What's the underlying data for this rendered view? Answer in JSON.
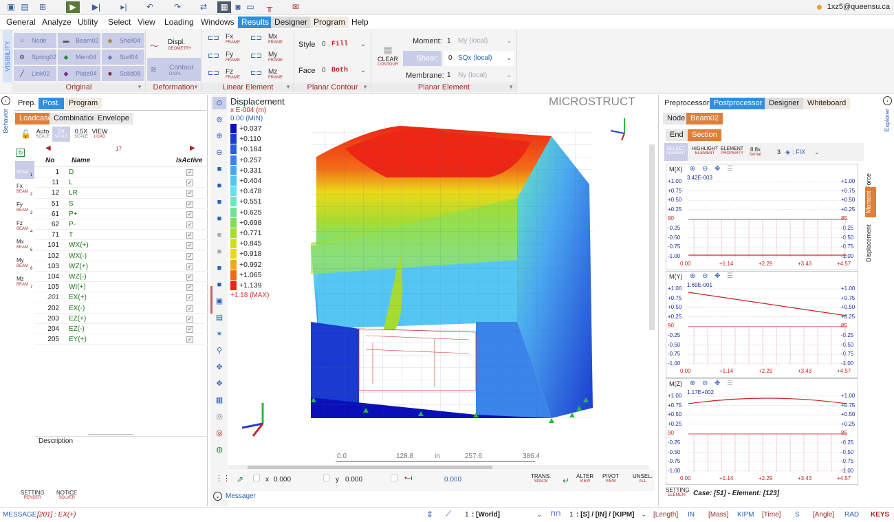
{
  "user": {
    "email": "1xz5@queensu.ca"
  },
  "menu": [
    "General",
    "Analyze",
    "Utility",
    "Select",
    "View",
    "Loading",
    "Windows",
    "Results",
    "Designer",
    "Program",
    "Help"
  ],
  "ribbon": {
    "visibility_label": "VISIBILITY",
    "original_tiles": [
      "Node",
      "Beam02",
      "Shell04",
      "Spring02",
      "Mem04",
      "Surf04",
      "Link02",
      "Plate04",
      "Solid08"
    ],
    "original_label": "Original",
    "displ_label": "Displ.",
    "displ_sub": "GEOMETRY",
    "contour_label": "Contour",
    "contour_sub": "DISPL.",
    "deformation_label": "Deformation",
    "linear_items": [
      {
        "label": "Fx",
        "sub": "FRAME"
      },
      {
        "label": "Mx",
        "sub": "FRAME"
      },
      {
        "label": "Fy",
        "sub": "FRAME"
      },
      {
        "label": "My",
        "sub": "FRAME"
      },
      {
        "label": "Fz",
        "sub": "FRAME"
      },
      {
        "label": "Mz",
        "sub": "FRAME"
      }
    ],
    "linear_label": "Linear Element",
    "style_label": "Style",
    "style_num": "0",
    "style_value": "Fill",
    "face_label": "Face",
    "face_num": "0",
    "face_value": "Both",
    "planar_contour_label": "Planar Contour",
    "clear_label": "CLEAR",
    "clear_sub": "CONTOUR",
    "moment_label": "Moment:",
    "moment_num": "1",
    "moment_value": "My (local)",
    "shear_label": "Shear:",
    "shear_num": "0",
    "shear_value": "SQx (local)",
    "membrane_label": "Membrane:",
    "membrane_num": "1",
    "membrane_value": "Ny (local)",
    "planar_element_label": "Planar Element"
  },
  "left": {
    "side_label": "Behavior",
    "tabs": [
      "Prep.",
      "Post.",
      "Program"
    ],
    "subtabs": [
      "Loadcase",
      "Combination",
      "Envelope"
    ],
    "auto": "Auto",
    "auto_sub": "SCALE",
    "scale2": "2X",
    "scale2_sub": "SCALE",
    "scale05": "0.5X",
    "scale05_sub": "SCALE",
    "view": "VIEW",
    "view_sub": "LOAD",
    "page_count": "17",
    "col_no": "No",
    "col_name": "Name",
    "col_active": "IsActive",
    "side_items": [
      {
        "label": "",
        "sub": "BEAM",
        "n": "1"
      },
      {
        "label": "Fx",
        "sub": "BEAM",
        "n": "2"
      },
      {
        "label": "Fy",
        "sub": "BEAM",
        "n": "3"
      },
      {
        "label": "Fz",
        "sub": "BEAM",
        "n": "4"
      },
      {
        "label": "Mx",
        "sub": "BEAM",
        "n": "5"
      },
      {
        "label": "My",
        "sub": "BEAM",
        "n": "6"
      },
      {
        "label": "Mz",
        "sub": "BEAM",
        "n": "7"
      }
    ],
    "rows": [
      {
        "no": "1",
        "name": "D"
      },
      {
        "no": "11",
        "name": "L"
      },
      {
        "no": "12",
        "name": "LR"
      },
      {
        "no": "51",
        "name": "S"
      },
      {
        "no": "61",
        "name": "P+"
      },
      {
        "no": "62",
        "name": "P-"
      },
      {
        "no": "71",
        "name": "T"
      },
      {
        "no": "101",
        "name": "WX(+)"
      },
      {
        "no": "102",
        "name": "WX(-)"
      },
      {
        "no": "103",
        "name": "WZ(+)"
      },
      {
        "no": "104",
        "name": "WZ(-)"
      },
      {
        "no": "105",
        "name": "WI(+)"
      },
      {
        "no": "201",
        "name": "EX(+)"
      },
      {
        "no": "202",
        "name": "EX(-)"
      },
      {
        "no": "203",
        "name": "EZ(+)"
      },
      {
        "no": "204",
        "name": "EZ(-)"
      },
      {
        "no": "205",
        "name": "EY(+)"
      }
    ],
    "description": "Description",
    "setting": "SETTING",
    "setting_sub": "RENDER",
    "notice": "NOTICE",
    "notice_sub": "SOLVER"
  },
  "view": {
    "title": "Displacement",
    "unit": "x E-004 (m)",
    "min_label": "0.00 (MIN)",
    "max_label": "+1.18 (MAX)",
    "brand": "MICROSTRUCT",
    "legend": [
      {
        "v": "+0.037",
        "c": "#0a10b8"
      },
      {
        "v": "+0.110",
        "c": "#1a3ad0"
      },
      {
        "v": "+0.184",
        "c": "#2a5ee0"
      },
      {
        "v": "+0.257",
        "c": "#3a84ea"
      },
      {
        "v": "+0.331",
        "c": "#4aa8f0"
      },
      {
        "v": "+0.404",
        "c": "#55c6f4"
      },
      {
        "v": "+0.478",
        "c": "#5ee4ea"
      },
      {
        "v": "+0.551",
        "c": "#66e8c0"
      },
      {
        "v": "+0.625",
        "c": "#6ee490"
      },
      {
        "v": "+0.698",
        "c": "#7edc5a"
      },
      {
        "v": "+0.771",
        "c": "#a6dc32"
      },
      {
        "v": "+0.845",
        "c": "#cce020"
      },
      {
        "v": "+0.918",
        "c": "#ecd81a"
      },
      {
        "v": "+0.992",
        "c": "#f6a818"
      },
      {
        "v": "+1.065",
        "c": "#f46a16"
      },
      {
        "v": "+1.139",
        "c": "#ee2614"
      }
    ],
    "ruler": [
      "0.0",
      "128.8",
      "in",
      "257.6",
      "386.4"
    ],
    "x_label": "x",
    "x_value": "0.000",
    "y_label": "y",
    "y_value": "0.000",
    "z_value": "0.000",
    "trans": "TRANS.",
    "trans_sub": "SPACE",
    "alter": "ALTER",
    "alter_sub": "VIEW",
    "pivot": "PIVOT",
    "pivot_sub": "VIEW",
    "unsel": "UNSEL.",
    "unsel_sub": "ALL",
    "messager": "Messager"
  },
  "right": {
    "side_label": "Explorer",
    "tabs": [
      "Preprocessor",
      "Postprocessor",
      "Designer",
      "Whiteboard"
    ],
    "subtabs": [
      "Node",
      "Beam02"
    ],
    "subtabs2": [
      "End",
      "Section"
    ],
    "select": "SELECT",
    "select_sub": "ELEMENT",
    "highlight": "HIGHLIGHT",
    "highlight_sub": "ELEMENT",
    "element": "ELEMENT",
    "element_sub": "PROPERTY",
    "format": "8.8x",
    "format_sub": "format",
    "fix_num": "3",
    "fix_label": ": FIX",
    "vtabs": [
      "Force",
      "Moment",
      "Displacement"
    ],
    "plots": [
      {
        "name": "M(X)",
        "value": "3.42E-003"
      },
      {
        "name": "M(Y)",
        "value": "1.69E-001"
      },
      {
        "name": "M(Z)",
        "value": "1.17E+002"
      }
    ],
    "ticks_left": [
      "+1.00",
      "+0.75",
      "+0.50",
      "+0.25",
      "90",
      "-0.25",
      "-0.50",
      "-0.75",
      "-1.00"
    ],
    "ticks_right": [
      "+1.00",
      "+0.75",
      "+0.50",
      "+0.25",
      "85",
      "-0.25",
      "-0.50",
      "-0.75",
      "-1.00"
    ],
    "x_ticks": [
      "0.00",
      "+1.14",
      "+2.29",
      "+3.43",
      "+4.57"
    ],
    "setting": "SETTING",
    "setting_sub": "ELEMENT",
    "case": "Case: [51] - Element: [123]"
  },
  "status": {
    "message_label": "MESSAGE:",
    "message": "[201] : EX(+)",
    "coord_num": "1",
    "coord": ": [World]",
    "units_num": "1",
    "units": ": [S] / [IN] / [KIPM]",
    "length": "[Length]",
    "length_v": "IN",
    "mass": "[Mass]",
    "mass_v": "KIPM",
    "time": "[Time]",
    "time_v": "S",
    "angle": "[Angle]",
    "angle_v": "RAD",
    "keys": "KEYS"
  }
}
